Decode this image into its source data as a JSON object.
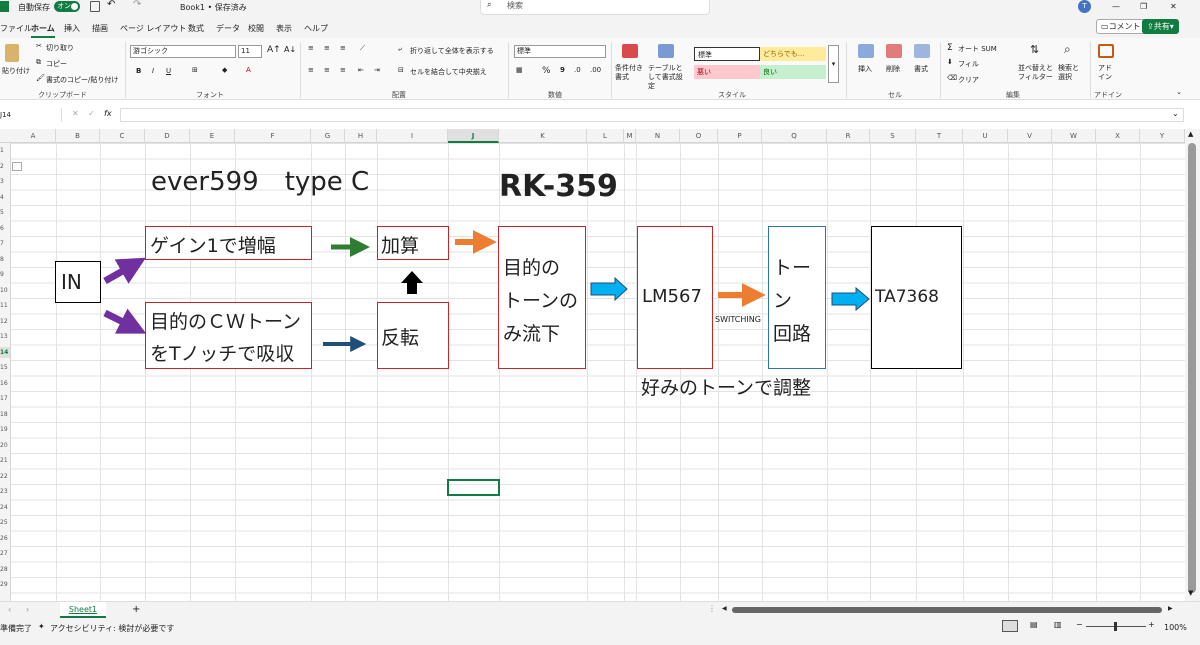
{
  "titlebar": {
    "autosave_label": "自動保存",
    "autosave_state": "オン",
    "doc_title": "Book1 • 保存済み",
    "search_placeholder": "検索",
    "user_initial": "T"
  },
  "menus": [
    "ファイル",
    "ホーム",
    "挿入",
    "描画",
    "ページ レイアウト",
    "数式",
    "データ",
    "校閲",
    "表示",
    "ヘルプ"
  ],
  "active_menu": "ホーム",
  "top_buttons": {
    "comment": "コメント",
    "share": "共有"
  },
  "ribbon": {
    "clipboard": {
      "paste": "貼り付け",
      "cut": "切り取り",
      "copy": "コピー",
      "format_painter": "書式のコピー/貼り付け",
      "group": "クリップボード"
    },
    "font": {
      "name": "游ゴシック",
      "size": "11",
      "group": "フォント"
    },
    "alignment": {
      "wrap": "折り返して全体を表示する",
      "merge": "セルを結合して中央揃え",
      "group": "配置"
    },
    "number": {
      "format": "標準",
      "group": "数値"
    },
    "styles": {
      "conditional": "条件付き書式",
      "table": "テーブルとして書式設定",
      "normal": "標準",
      "neutral": "どちらでも...",
      "bad": "悪い",
      "good": "良い",
      "group": "スタイル"
    },
    "cells": {
      "insert": "挿入",
      "delete": "削除",
      "format": "書式",
      "group": "セル"
    },
    "editing": {
      "autosum": "オート SUM",
      "fill": "フィル",
      "clear": "クリア",
      "sort": "並べ替えとフィルター",
      "find": "検索と選択",
      "group": "編集"
    },
    "addins": {
      "label": "アドイン",
      "group": "アドイン"
    }
  },
  "formula_bar": {
    "name_box": "J14",
    "fx": "fx",
    "content": ""
  },
  "columns": [
    "A",
    "B",
    "C",
    "D",
    "E",
    "F",
    "G",
    "H",
    "I",
    "J",
    "K",
    "L",
    "M",
    "N",
    "O",
    "P",
    "Q",
    "R",
    "S",
    "T",
    "U",
    "V",
    "W",
    "X",
    "Y"
  ],
  "selected_column": "J",
  "rows": [
    "1",
    "2",
    "3",
    "4",
    "5",
    "6",
    "7",
    "8",
    "9",
    "10",
    "11",
    "12",
    "13",
    "14",
    "15",
    "16",
    "17",
    "18",
    "19",
    "20",
    "21",
    "22",
    "23",
    "24",
    "25",
    "26",
    "27",
    "28",
    "29"
  ],
  "selected_row": "14",
  "sheet": {
    "title1": "ever599　type C",
    "title2": "RK-359",
    "box_in": "IN",
    "box_gain": "ゲイン1で増幅",
    "box_cw_line1": "目的のＣＷトーン",
    "box_cw_line2": "をTノッチで吸収",
    "box_add": "加算",
    "box_invert": "反転",
    "box_pass_line1": "目的の",
    "box_pass_line2": "トーンの",
    "box_pass_line3": "み流下",
    "box_lm": "LM567",
    "switching": "SWITCHING",
    "box_tone_line1": "トー",
    "box_tone_line2": "ン",
    "box_tone_line3": "回路",
    "box_ta": "TA7368",
    "note": "好みのトーンで調整"
  },
  "tabs": {
    "sheet1": "Sheet1",
    "add": "+"
  },
  "status": {
    "ready": "準備完了",
    "accessibility": "アクセシビリティ: 検討が必要です",
    "zoom": "100%"
  },
  "colors": {
    "accent": "#107c41",
    "box_red": "#c0262c",
    "arrow_purple": "#7030a0",
    "arrow_green": "#2e7d32",
    "arrow_orange": "#ed7d31",
    "arrow_navy": "#1f4e79",
    "arrow_cyan": "#00b0f0"
  }
}
